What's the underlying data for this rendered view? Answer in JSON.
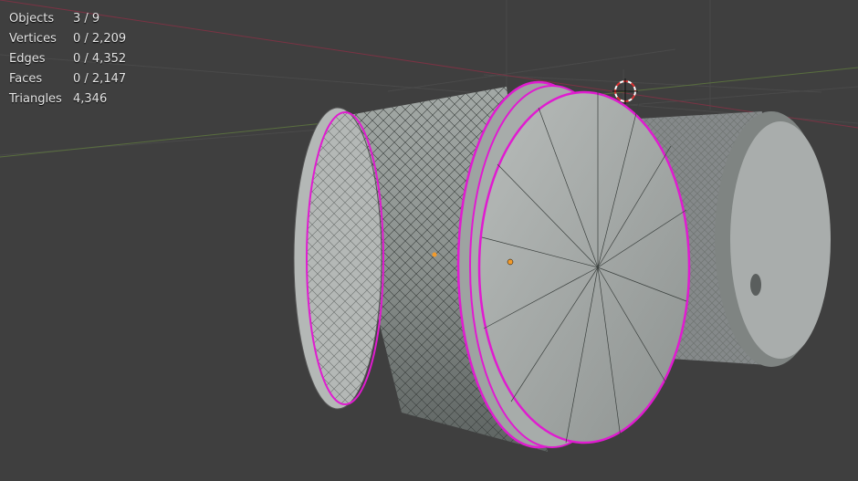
{
  "overlay": {
    "stats": [
      {
        "label": "Objects",
        "value": "3 / 9"
      },
      {
        "label": "Vertices",
        "value": "0 / 2,209"
      },
      {
        "label": "Edges",
        "value": "0 / 4,352"
      },
      {
        "label": "Faces",
        "value": "0 / 2,147"
      },
      {
        "label": "Triangles",
        "value": "4,346"
      }
    ]
  },
  "colors": {
    "background": "#3f3f3f",
    "selection_outline": "#e01bd0",
    "x_axis": "#c0415a",
    "y_axis": "#7aa24a",
    "origin_dot": "#f29a2a"
  }
}
